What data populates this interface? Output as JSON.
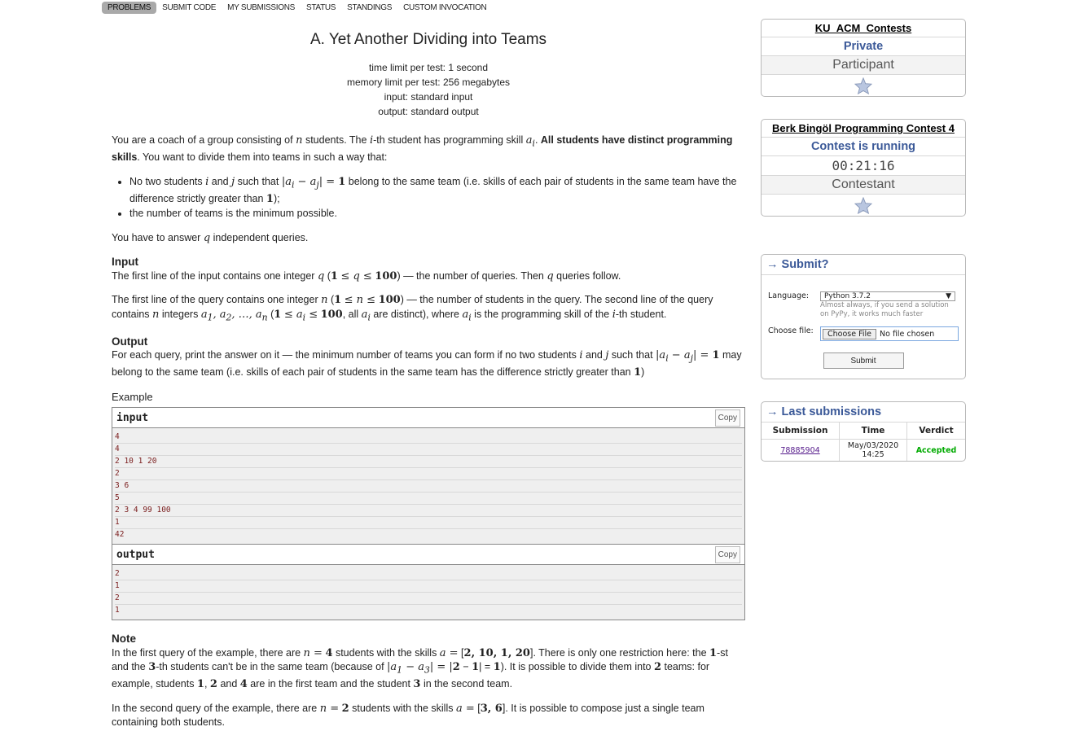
{
  "menu": [
    "PROBLEMS",
    "SUBMIT CODE",
    "MY SUBMISSIONS",
    "STATUS",
    "STANDINGS",
    "CUSTOM INVOCATION"
  ],
  "problem": {
    "title": "A. Yet Another Dividing into Teams",
    "time_limit": "time limit per test: 1 second",
    "memory_limit": "memory limit per test: 256 megabytes",
    "input_file": "input: standard input",
    "output_file": "output: standard output",
    "input_heading": "Input",
    "output_heading": "Output",
    "example_heading": "Example",
    "note_heading": "Note",
    "input_label": "input",
    "output_label": "output",
    "copy_label": "Copy",
    "example_input": [
      "4",
      "4",
      "2 10 1 20",
      "2",
      "3 6",
      "5",
      "2 3 4 99 100",
      "1",
      "42"
    ],
    "example_output": [
      "2",
      "1",
      "2",
      "1"
    ]
  },
  "sidebar": {
    "contest_box": {
      "title": "KU_ACM_Contests",
      "type": "Private",
      "role": "Participant"
    },
    "running_box": {
      "title": "Berk Bingöl Programming Contest 4",
      "status": "Contest is running",
      "timer": "00:21:16",
      "role": "Contestant"
    },
    "submit_box": {
      "title": "→ Submit?",
      "language_label": "Language:",
      "language_value": "Python 3.7.2",
      "hint": "Almost always, if you send a solution on PyPy, it works much faster",
      "file_label": "Choose file:",
      "file_button": "Choose File",
      "file_status": "No file chosen",
      "submit_label": "Submit"
    },
    "last_submissions": {
      "title": "→ Last submissions",
      "headers": [
        "Submission",
        "Time",
        "Verdict"
      ],
      "rows": [
        {
          "id": "78885904",
          "time": "May/03/2020 14:25",
          "verdict": "Accepted"
        }
      ]
    }
  },
  "colors": {
    "link_blue": "#3b5998",
    "accepted": "#00aa00",
    "example_text": "#7a1d1d"
  }
}
